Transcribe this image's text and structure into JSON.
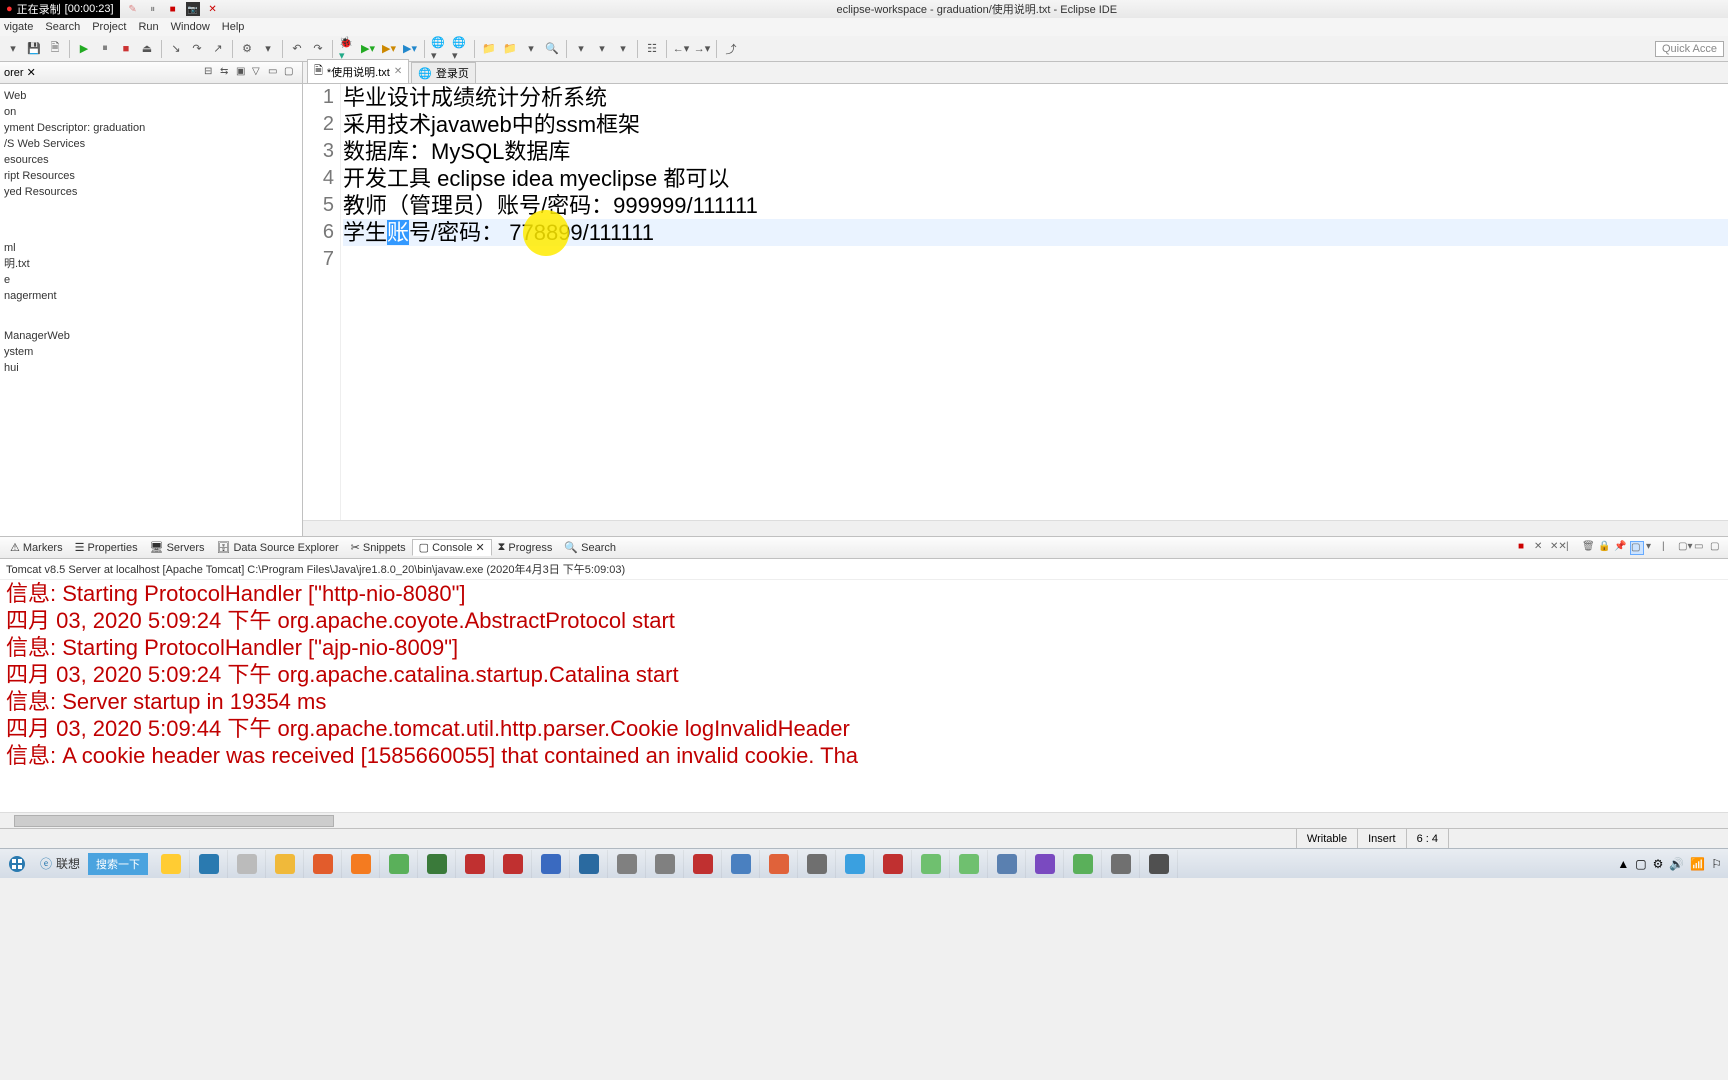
{
  "recording": {
    "label": "正在录制",
    "time": "[00:00:23]"
  },
  "title": "eclipse-workspace - graduation/使用说明.txt - Eclipse IDE",
  "menu": [
    "vigate",
    "Search",
    "Project",
    "Run",
    "Window",
    "Help"
  ],
  "quick_access": "Quick Acce",
  "explorer": {
    "tab": "orer",
    "items": [
      "Web",
      "on",
      "yment Descriptor: graduation",
      "/S Web Services",
      "esources",
      "ript Resources",
      "yed Resources",
      "",
      "ml",
      "明.txt",
      "e",
      "nagerment",
      "",
      "ManagerWeb",
      "ystem",
      "hui"
    ]
  },
  "editor": {
    "tabs": [
      {
        "label": "*使用说明.txt",
        "active": true,
        "icon": "text-file-icon"
      },
      {
        "label": "登录页",
        "active": false,
        "icon": "globe-icon"
      }
    ],
    "lines": [
      "毕业设计成绩统计分析系统",
      "采用技术javaweb中的ssm框架",
      "数据库：MySQL数据库",
      "开发工具 eclipse idea myeclipse 都可以",
      "教师（管理员）账号/密码：999999/111111",
      "学生账号/密码： 778899/111111",
      ""
    ],
    "line6_parts": {
      "pre": "学生",
      "sel": "账",
      "post": "号/密码： 778899/111111"
    }
  },
  "bottom_tabs": [
    "Markers",
    "Properties",
    "Servers",
    "Data Source Explorer",
    "Snippets",
    "Console",
    "Progress",
    "Search"
  ],
  "bottom_active": "Console",
  "server_line": "Tomcat v8.5 Server at localhost [Apache Tomcat] C:\\Program Files\\Java\\jre1.8.0_20\\bin\\javaw.exe (2020年4月3日 下午5:09:03)",
  "console": [
    "信息: Starting ProtocolHandler [\"http-nio-8080\"]",
    "四月 03, 2020 5:09:24 下午 org.apache.coyote.AbstractProtocol start",
    "信息: Starting ProtocolHandler [\"ajp-nio-8009\"]",
    "四月 03, 2020 5:09:24 下午 org.apache.catalina.startup.Catalina start",
    "信息: Server startup in 19354 ms",
    "四月 03, 2020 5:09:44 下午 org.apache.tomcat.util.http.parser.Cookie logInvalidHeader",
    "信息: A cookie header was received [1585660055] that contained an invalid cookie. Tha"
  ],
  "status": {
    "writable": "Writable",
    "insert": "Insert",
    "pos": "6 : 4"
  },
  "taskbar": {
    "brand": "联想",
    "search": "搜索一下"
  },
  "tb_colors": [
    "#ffcc33",
    "#2a7ab0",
    "#bbbbbb",
    "#f0b93a",
    "#e25c2c",
    "#f47b20",
    "#5ab05a",
    "#3a7a3a",
    "#c03030",
    "#c03030",
    "#3a6ac0",
    "#2a6aa0",
    "#808080",
    "#808080",
    "#c03030",
    "#4a80c0",
    "#e0623a",
    "#6f6f6f",
    "#3aa0e0",
    "#c03030",
    "#6fc06f",
    "#6fc06f",
    "#5a80b0",
    "#7a4ac0",
    "#5ab05a",
    "#707070",
    "#505050"
  ]
}
